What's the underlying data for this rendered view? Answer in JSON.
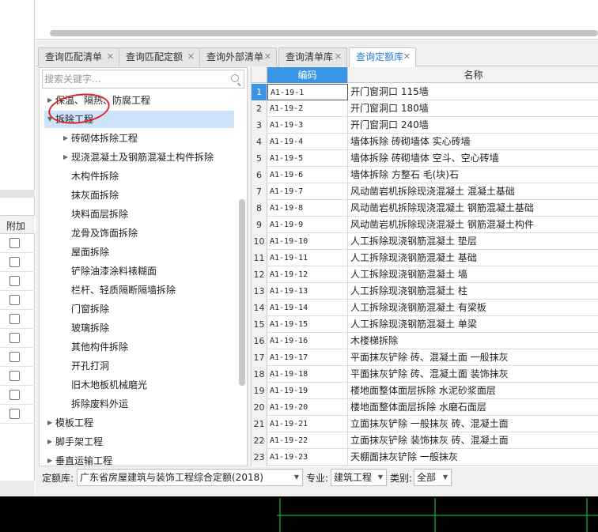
{
  "left_strip": {
    "header": "附加",
    "checkbox_count": 10
  },
  "tabs": [
    {
      "label": "查询匹配清单",
      "active": false
    },
    {
      "label": "查询匹配定额",
      "active": false
    },
    {
      "label": "查询外部清单",
      "active": false
    },
    {
      "label": "查询清单库",
      "active": false
    },
    {
      "label": "查询定额库",
      "active": true
    }
  ],
  "search": {
    "placeholder": "搜索关键字..."
  },
  "tree": [
    {
      "label": "保温、隔热、防腐工程",
      "level": 0,
      "expandable": true,
      "expanded": false,
      "selected": false
    },
    {
      "label": "拆除工程",
      "level": 0,
      "expandable": true,
      "expanded": true,
      "selected": true
    },
    {
      "label": "砖砌体拆除工程",
      "level": 1,
      "expandable": true,
      "expanded": false,
      "selected": false
    },
    {
      "label": "现浇混凝土及钢筋混凝土构件拆除",
      "level": 1,
      "expandable": true,
      "expanded": false,
      "selected": false
    },
    {
      "label": "木构件拆除",
      "level": 1,
      "expandable": false
    },
    {
      "label": "抹灰面拆除",
      "level": 1,
      "expandable": false
    },
    {
      "label": "块料面层拆除",
      "level": 1,
      "expandable": false
    },
    {
      "label": "龙骨及饰面拆除",
      "level": 1,
      "expandable": false
    },
    {
      "label": "屋面拆除",
      "level": 1,
      "expandable": false
    },
    {
      "label": "铲除油漆涂料裱糊面",
      "level": 1,
      "expandable": false
    },
    {
      "label": "栏杆、轻质隔断隔墙拆除",
      "level": 1,
      "expandable": false
    },
    {
      "label": "门窗拆除",
      "level": 1,
      "expandable": false
    },
    {
      "label": "玻璃拆除",
      "level": 1,
      "expandable": false
    },
    {
      "label": "其他构件拆除",
      "level": 1,
      "expandable": false
    },
    {
      "label": "开孔打洞",
      "level": 1,
      "expandable": false
    },
    {
      "label": "旧木地板机械磨光",
      "level": 1,
      "expandable": false
    },
    {
      "label": "拆除废料外运",
      "level": 1,
      "expandable": false
    },
    {
      "label": "模板工程",
      "level": 0,
      "expandable": true,
      "expanded": false
    },
    {
      "label": "脚手架工程",
      "level": 0,
      "expandable": true,
      "expanded": false
    },
    {
      "label": "垂直运输工程",
      "level": 0,
      "expandable": true,
      "expanded": false
    }
  ],
  "table": {
    "columns": [
      "编码",
      "名称"
    ],
    "selected_row": 1,
    "rows": [
      {
        "num": "1",
        "code": "A1-19-1",
        "name": "开门窗洞口 115墙"
      },
      {
        "num": "2",
        "code": "A1-19-2",
        "name": "开门窗洞口 180墙"
      },
      {
        "num": "3",
        "code": "A1-19-3",
        "name": "开门窗洞口 240墙"
      },
      {
        "num": "4",
        "code": "A1-19-4",
        "name": "墙体拆除 砖砌墙体 实心砖墙"
      },
      {
        "num": "5",
        "code": "A1-19-5",
        "name": "墙体拆除 砖砌墙体 空斗、空心砖墙"
      },
      {
        "num": "6",
        "code": "A1-19-6",
        "name": "墙体拆除 方整石 毛(块)石"
      },
      {
        "num": "7",
        "code": "A1-19-7",
        "name": "风动凿岩机拆除现浇混凝土 混凝土基础"
      },
      {
        "num": "8",
        "code": "A1-19-8",
        "name": "风动凿岩机拆除现浇混凝土 钢筋混凝土基础"
      },
      {
        "num": "9",
        "code": "A1-19-9",
        "name": "风动凿岩机拆除现浇混凝土 钢筋混凝土构件"
      },
      {
        "num": "10",
        "code": "A1-19-10",
        "name": "人工拆除现浇钢筋混凝土 垫层"
      },
      {
        "num": "11",
        "code": "A1-19-11",
        "name": "人工拆除现浇钢筋混凝土 基础"
      },
      {
        "num": "12",
        "code": "A1-19-12",
        "name": "人工拆除现浇钢筋混凝土 墙"
      },
      {
        "num": "13",
        "code": "A1-19-13",
        "name": "人工拆除现浇钢筋混凝土 柱"
      },
      {
        "num": "14",
        "code": "A1-19-14",
        "name": "人工拆除现浇钢筋混凝土 有梁板"
      },
      {
        "num": "15",
        "code": "A1-19-15",
        "name": "人工拆除现浇钢筋混凝土 单梁"
      },
      {
        "num": "16",
        "code": "A1-19-16",
        "name": "木楼梯拆除"
      },
      {
        "num": "17",
        "code": "A1-19-17",
        "name": "平面抹灰铲除 砖、混凝土面 一般抹灰"
      },
      {
        "num": "18",
        "code": "A1-19-18",
        "name": "平面抹灰铲除 砖、混凝土面 装饰抹灰"
      },
      {
        "num": "19",
        "code": "A1-19-19",
        "name": "楼地面整体面层拆除 水泥砂浆面层"
      },
      {
        "num": "20",
        "code": "A1-19-20",
        "name": "楼地面整体面层拆除 水磨石面层"
      },
      {
        "num": "21",
        "code": "A1-19-21",
        "name": "立面抹灰铲除 一般抹灰 砖、混凝土面"
      },
      {
        "num": "22",
        "code": "A1-19-22",
        "name": "立面抹灰铲除 装饰抹灰 砖、混凝土面"
      },
      {
        "num": "23",
        "code": "A1-19-23",
        "name": "天棚面抹灰铲除 一般抹灰"
      }
    ]
  },
  "bottom": {
    "quota_label": "定额库:",
    "quota_value": "广东省房屋建筑与装饰工程综合定额(2018)",
    "major_label": "专业:",
    "major_value": "建筑工程",
    "category_label": "类别:",
    "category_value": "全部"
  },
  "colors": {
    "accent": "#3b95e6",
    "selection": "#cde3fa",
    "annotation": "#e0262b"
  },
  "icons": {
    "search": "magnifier-icon",
    "tab_close": "close-icon",
    "dropdown": "caret-down-icon"
  }
}
